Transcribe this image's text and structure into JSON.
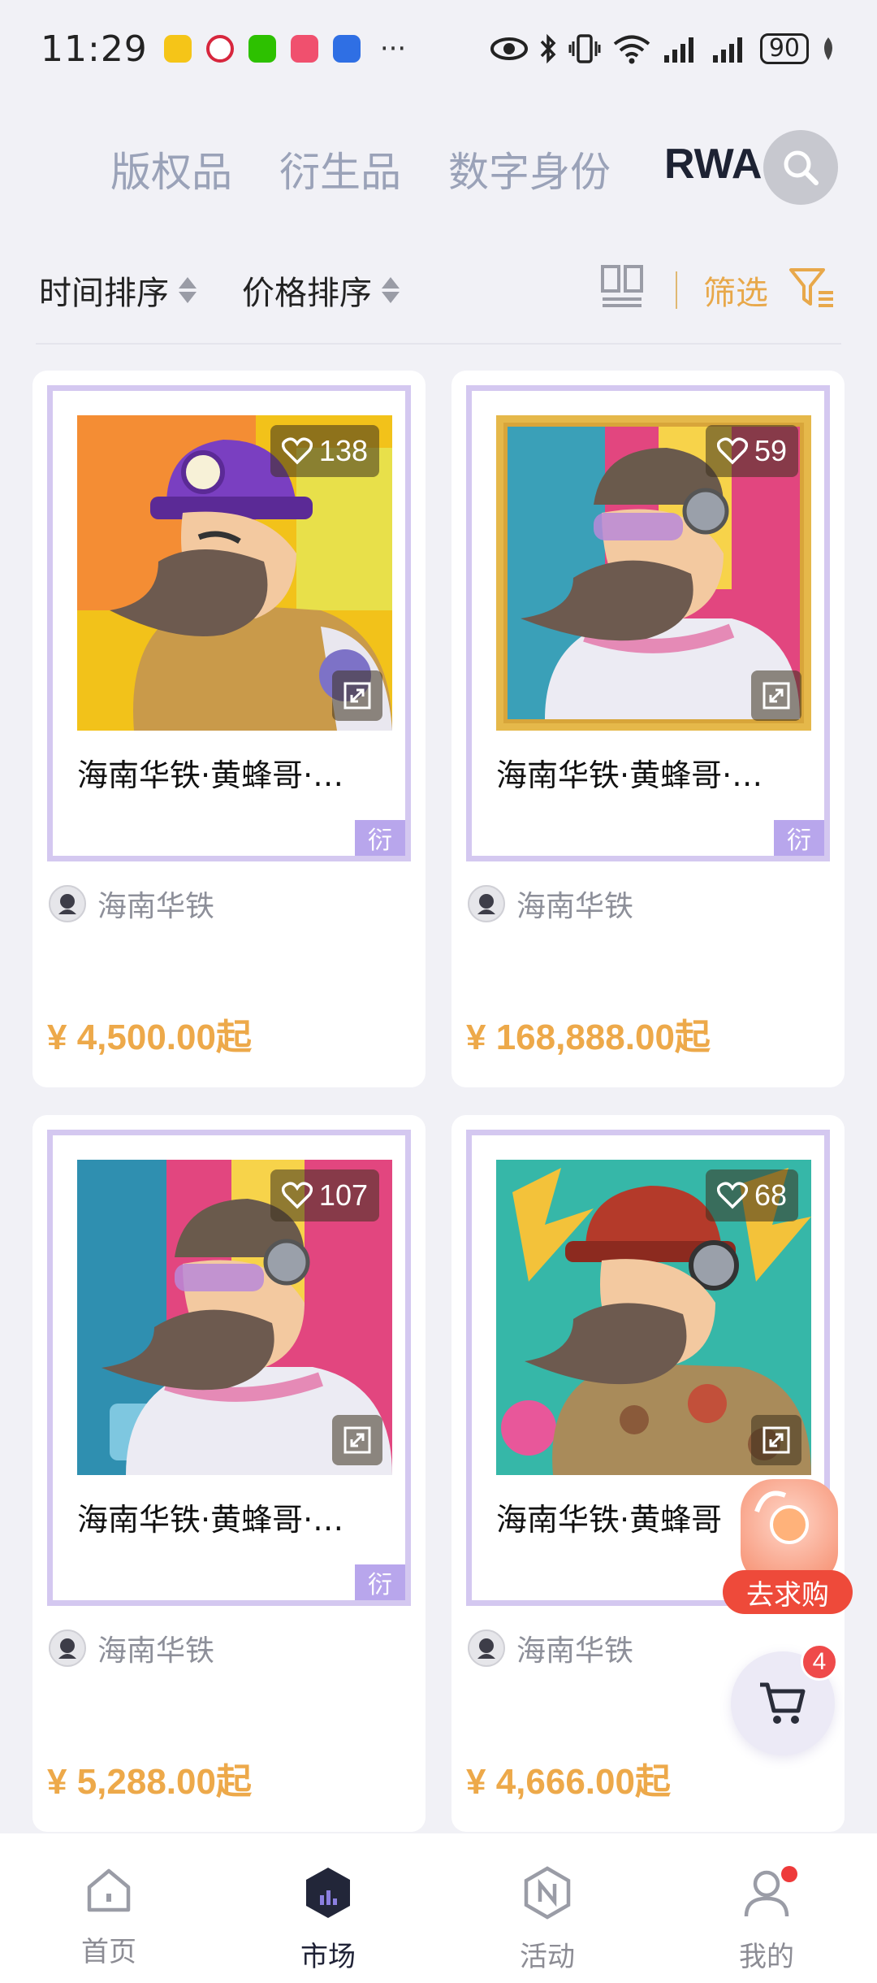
{
  "status_bar": {
    "time": "11:29",
    "battery": "90",
    "more": "···"
  },
  "tabs": [
    {
      "label": "版权品",
      "active": false
    },
    {
      "label": "衍生品",
      "active": false
    },
    {
      "label": "数字身份",
      "active": false
    },
    {
      "label": "RWA",
      "active": true
    }
  ],
  "sort": {
    "time_sort": "时间排序",
    "price_sort": "价格排序",
    "filter": "筛选"
  },
  "products": [
    {
      "title": "海南华铁·黄蜂哥·…",
      "likes": "138",
      "tag": "衍",
      "creator": "海南华铁",
      "price": "¥ 4,500.00起"
    },
    {
      "title": "海南华铁·黄蜂哥·…",
      "likes": "59",
      "tag": "衍",
      "creator": "海南华铁",
      "price": "¥ 168,888.00起"
    },
    {
      "title": "海南华铁·黄蜂哥·…",
      "likes": "107",
      "tag": "衍",
      "creator": "海南华铁",
      "price": "¥ 5,288.00起"
    },
    {
      "title": "海南华铁·黄蜂哥",
      "likes": "68",
      "tag": "",
      "creator": "海南华铁",
      "price": "¥ 4,666.00起"
    }
  ],
  "float": {
    "buy_label": "去求购",
    "cart_count": "4"
  },
  "nav": [
    {
      "label": "首页",
      "icon": "home-icon"
    },
    {
      "label": "市场",
      "icon": "market-icon",
      "active": true
    },
    {
      "label": "活动",
      "icon": "activity-icon"
    },
    {
      "label": "我的",
      "icon": "profile-icon"
    }
  ],
  "colors": {
    "accent": "#e8a84a",
    "frame": "#d4c8f0",
    "tag": "#b8a6ec",
    "active_tab": "#1d2233"
  }
}
